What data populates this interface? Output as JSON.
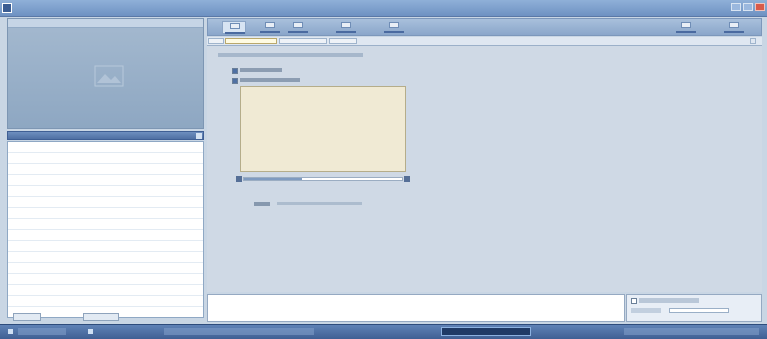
{
  "app": {
    "title": ""
  },
  "ribbon": {
    "tabs": [
      {
        "label": ""
      },
      {
        "label": ""
      },
      {
        "label": ""
      },
      {
        "label": ""
      },
      {
        "label": ""
      },
      {
        "label": ""
      },
      {
        "label": ""
      }
    ]
  },
  "doc_tabs": [
    {
      "label": ""
    },
    {
      "label": ""
    },
    {
      "label": ""
    },
    {
      "label": ""
    }
  ],
  "left_panel": {
    "section_label": "",
    "footer_buttons": [
      {
        "label": ""
      },
      {
        "label": ""
      }
    ]
  },
  "content": {
    "heading": "",
    "option_1": {
      "label": "",
      "checked": true
    },
    "option_2": {
      "label": "",
      "checked": true
    },
    "slider": {
      "value": 0.37
    },
    "field": {
      "label": "",
      "hint": ""
    }
  },
  "right_panel": {
    "checkbox_label": "",
    "items": [
      "",
      ""
    ]
  },
  "status_bar": {
    "left_text": "",
    "middle_text": "",
    "center_text": "",
    "right_text": ""
  },
  "colors": {
    "accent": "#4f70a3",
    "content_bg": "#cfd9e5",
    "preview_box": "#f0ead4",
    "status_bg": "#3f5f93"
  }
}
